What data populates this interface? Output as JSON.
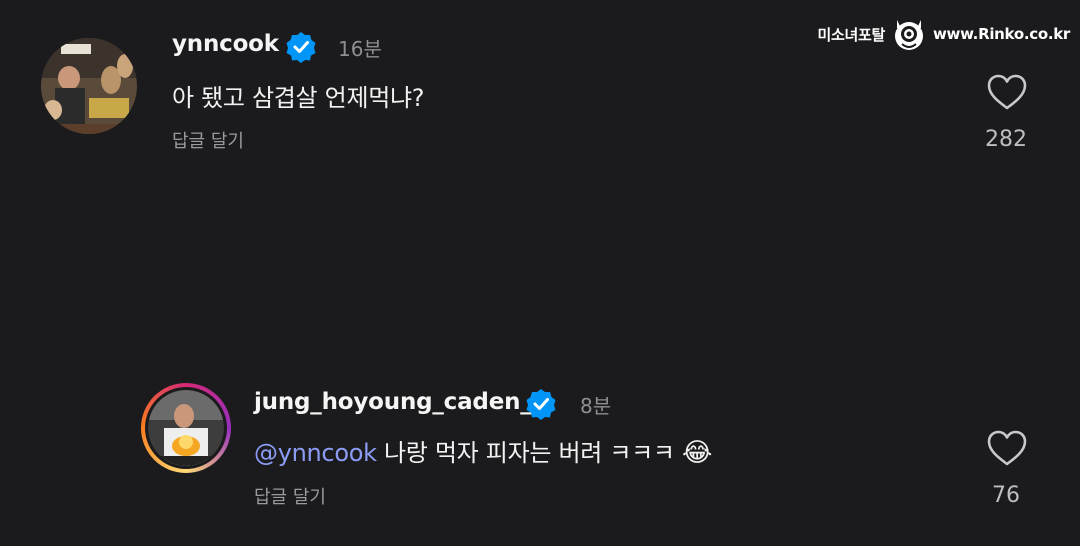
{
  "watermark": {
    "text": "미소녀포탈",
    "url": "www.Rinko.co.kr"
  },
  "comments": [
    {
      "username": "ynncook",
      "time": "16분",
      "text": "아 됐고 삼겹살 언제먹냐?",
      "reply_label": "답글 달기",
      "likes": "282"
    },
    {
      "username": "jung_hoyoung_caden_",
      "time": "8분",
      "mention": "@ynncook",
      "text": " 나랑 먹자 피자는 버려 ㅋㅋㅋ ",
      "emoji": "😂",
      "reply_label": "답글 달기",
      "likes": "76"
    }
  ],
  "colors": {
    "background": "#1b1b1d",
    "verified": "#0095f6",
    "mention": "#8c9cf5",
    "story_ring": "#e1306c"
  }
}
